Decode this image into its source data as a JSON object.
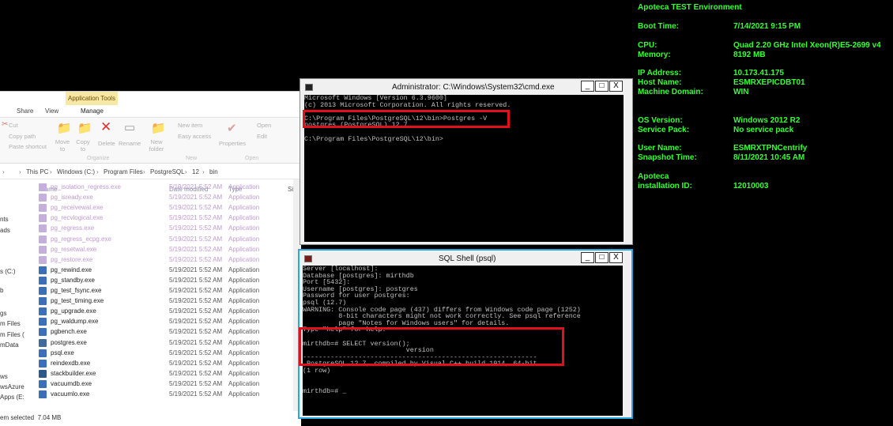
{
  "bginfo": {
    "title": "Apoteca TEST Environment",
    "rows": [
      {
        "key": "Boot Time:",
        "value": "7/14/2021 9:15 PM"
      },
      {
        "key": "CPU:",
        "value": "Quad 2.20 GHz Intel Xeon(R)E5-2699 v4"
      },
      {
        "key": "Memory:",
        "value": "8192 MB"
      },
      {
        "key": "IP Address:",
        "value": "10.173.41.175"
      },
      {
        "key": "Host Name:",
        "value": "ESMRXEPICDBT01"
      },
      {
        "key": "Machine Domain:",
        "value": "WIN"
      },
      {
        "key": "OS Version:",
        "value": "Windows 2012 R2"
      },
      {
        "key": "Service Pack:",
        "value": "No service pack"
      },
      {
        "key": "User Name:",
        "value": "ESMRXTPNCentrify"
      },
      {
        "key": "Snapshot Time:",
        "value": "8/11/2021 10:45 AM"
      },
      {
        "key": "Apoteca",
        "value": ""
      },
      {
        "key": "installation ID:",
        "value": "12010003"
      }
    ]
  },
  "explorer": {
    "app_tools": "Application Tools",
    "tabs": [
      "Share",
      "View",
      "Manage"
    ],
    "ribbon": {
      "cut": "Cut",
      "copy_path": "Copy path",
      "paste_shortcut": "Paste shortcut",
      "move_to": "Move to",
      "copy_to": "Copy to",
      "delete": "Delete",
      "rename": "Rename",
      "new_folder": "New folder",
      "new_item": "New item",
      "easy_access": "Easy access",
      "properties": "Properties",
      "open": "Open",
      "edit": "Edit",
      "group_organize": "Organize",
      "group_new": "New",
      "group_open": "Open"
    },
    "breadcrumb": [
      "This PC",
      "Windows (C:)",
      "Program Files",
      "PostgreSQL",
      "12",
      "bin"
    ],
    "columns": {
      "name": "Name",
      "date": "Date modified",
      "type": "Type",
      "size": "Size"
    },
    "nav": [
      "nts",
      "ads",
      "s (C:)",
      "b",
      "gs",
      "m Files",
      "m Files (",
      "mData",
      "ws",
      "wsAzure",
      "Apps (E:"
    ],
    "files": [
      {
        "name": "pg_isolation_regress.exe",
        "date": "5/19/2021 5:52 AM",
        "type": "Application",
        "faded": true
      },
      {
        "name": "pg_isready.exe",
        "date": "5/19/2021 5:52 AM",
        "type": "Application",
        "faded": true
      },
      {
        "name": "pg_receivewal.exe",
        "date": "5/19/2021 5:52 AM",
        "type": "Application",
        "faded": true
      },
      {
        "name": "pg_recvlogical.exe",
        "date": "5/19/2021 5:52 AM",
        "type": "Application",
        "faded": true
      },
      {
        "name": "pg_regress.exe",
        "date": "5/19/2021 5:52 AM",
        "type": "Application",
        "faded": true
      },
      {
        "name": "pg_regress_ecpg.exe",
        "date": "5/19/2021 5:52 AM",
        "type": "Application",
        "faded": true
      },
      {
        "name": "pg_resetwal.exe",
        "date": "5/19/2021 5:52 AM",
        "type": "Application",
        "faded": true
      },
      {
        "name": "pg_restore.exe",
        "date": "5/19/2021 5:52 AM",
        "type": "Application",
        "faded": true
      },
      {
        "name": "pg_rewind.exe",
        "date": "5/19/2021 5:52 AM",
        "type": "Application",
        "faded": false
      },
      {
        "name": "pg_standby.exe",
        "date": "5/19/2021 5:52 AM",
        "type": "Application",
        "faded": false
      },
      {
        "name": "pg_test_fsync.exe",
        "date": "5/19/2021 5:52 AM",
        "type": "Application",
        "faded": false
      },
      {
        "name": "pg_test_timing.exe",
        "date": "5/19/2021 5:52 AM",
        "type": "Application",
        "faded": false
      },
      {
        "name": "pg_upgrade.exe",
        "date": "5/19/2021 5:52 AM",
        "type": "Application",
        "faded": false
      },
      {
        "name": "pg_waldump.exe",
        "date": "5/19/2021 5:52 AM",
        "type": "Application",
        "faded": false
      },
      {
        "name": "pgbench.exe",
        "date": "5/19/2021 5:52 AM",
        "type": "Application",
        "faded": false
      },
      {
        "name": "postgres.exe",
        "date": "5/19/2021 5:52 AM",
        "type": "Application",
        "faded": false
      },
      {
        "name": "psql.exe",
        "date": "5/19/2021 5:52 AM",
        "type": "Application",
        "faded": false
      },
      {
        "name": "reindexdb.exe",
        "date": "5/19/2021 5:52 AM",
        "type": "Application",
        "faded": false
      },
      {
        "name": "stackbuilder.exe",
        "date": "5/19/2021 5:52 AM",
        "type": "Application",
        "faded": false
      },
      {
        "name": "vacuumdb.exe",
        "date": "5/19/2021 5:52 AM",
        "type": "Application",
        "faded": false
      },
      {
        "name": "vacuumlo.exe",
        "date": "5/19/2021 5:52 AM",
        "type": "Application",
        "faded": false
      }
    ],
    "status": "em selected  7.04 MB"
  },
  "cmd": {
    "title": "Administrator: C:\\Windows\\System32\\cmd.exe",
    "lines": [
      "Microsoft Windows [Version 6.3.9600]",
      "(c) 2013 Microsoft Corporation. All rights reserved.",
      "",
      "C:\\Program Files\\PostgreSQL\\12\\bin>Postgres -V",
      "postgres (PostgreSQL) 12.7",
      "",
      "C:\\Program Files\\PostgreSQL\\12\\bin>"
    ]
  },
  "psql": {
    "title": "SQL Shell (psql)",
    "lines": [
      "Server [localhost]:",
      "Database [postgres]: mirthdb",
      "Port [5432]:",
      "Username [postgres]: postgres",
      "Password for user postgres:",
      "psql (12.7)",
      "WARNING: Console code page (437) differs from Windows code page (1252)",
      "         8-bit characters might not work correctly. See psql reference",
      "         page \"Notes for Windows users\" for details.",
      "Type \"help\" for help.",
      "",
      "mirthdb=# SELECT version();",
      "                          version",
      "-----------------------------------------------------------",
      " PostgreSQL 12.7, compiled by Visual C++ build 1914, 64-bit",
      "(1 row)",
      "",
      "",
      "mirthdb=# _"
    ]
  },
  "window_buttons": {
    "minimize": "_",
    "maximize": "□",
    "close": "X"
  }
}
